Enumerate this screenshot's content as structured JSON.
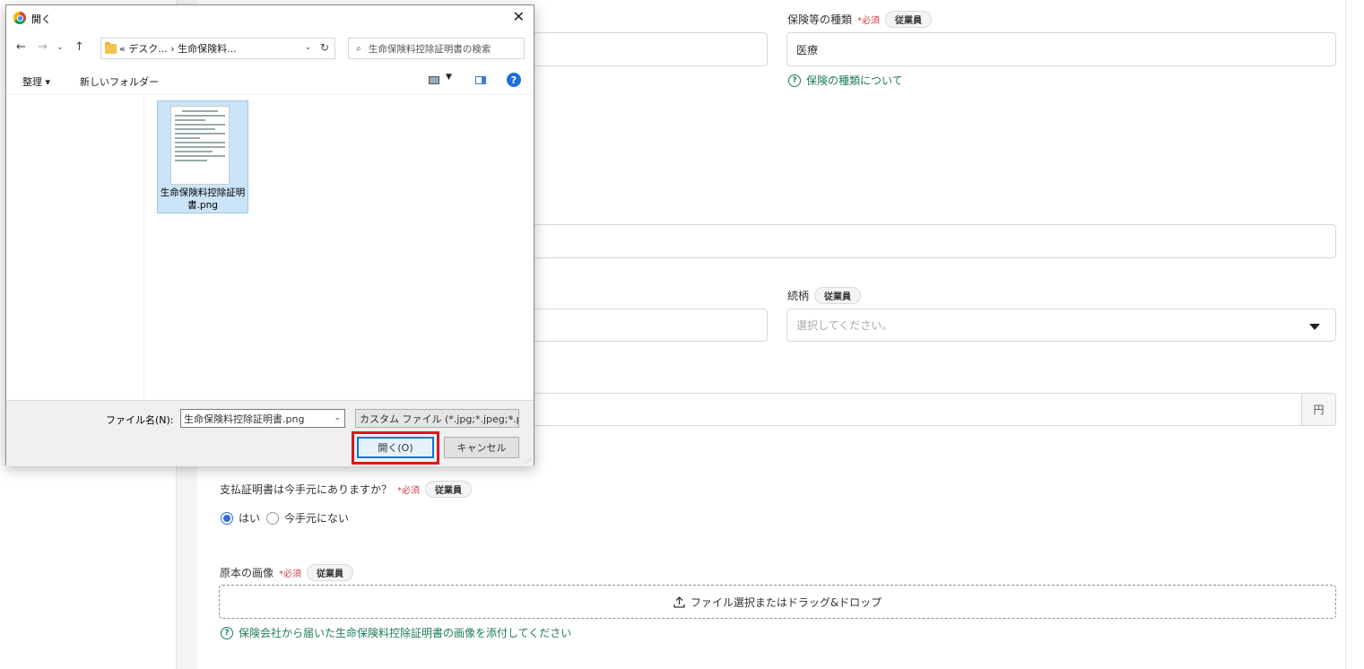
{
  "form": {
    "insurance_type": {
      "label": "保険等の種類",
      "required": "*必須",
      "badge": "従業員",
      "value": "医療",
      "help": "保険の種類について"
    },
    "relationship": {
      "label": "続柄",
      "badge": "従業員",
      "placeholder": "選択してください。"
    },
    "amount": {
      "unit": "円"
    },
    "certificate_question": {
      "label": "支払証明書は今手元にありますか？",
      "required": "*必須",
      "badge": "従業員",
      "options": [
        {
          "label": "はい",
          "checked": true
        },
        {
          "label": "今手元にない",
          "checked": false
        }
      ]
    },
    "original_image": {
      "label": "原本の画像",
      "required": "*必須",
      "badge": "従業員",
      "dropzone": "ファイル選択またはドラッグ&ドロップ",
      "help": "保険会社から届いた生命保険料控除証明書の画像を添付してください"
    }
  },
  "dialog": {
    "title": "開く",
    "close": "✕",
    "address": "« デスク... › 生命保険料...",
    "search_placeholder": "生命保険料控除証明書の検索",
    "toolbar": {
      "organize": "整理 ▾",
      "new_folder": "新しいフォルダー"
    },
    "files": [
      {
        "name": "生命保険料控除証明書.png"
      }
    ],
    "filename_label": "ファイル名(N):",
    "filename_value": "生命保険料控除証明書.png",
    "filetype": "カスタム ファイル (*.jpg;*.jpeg;*.pn",
    "open_button": "開く(O)",
    "cancel_button": "キャンセル"
  },
  "colors": {
    "accent_green": "#1d7f55",
    "required_red": "#d23c4a",
    "radio_blue": "#2f6fd6",
    "highlight_red": "#e0141e"
  }
}
